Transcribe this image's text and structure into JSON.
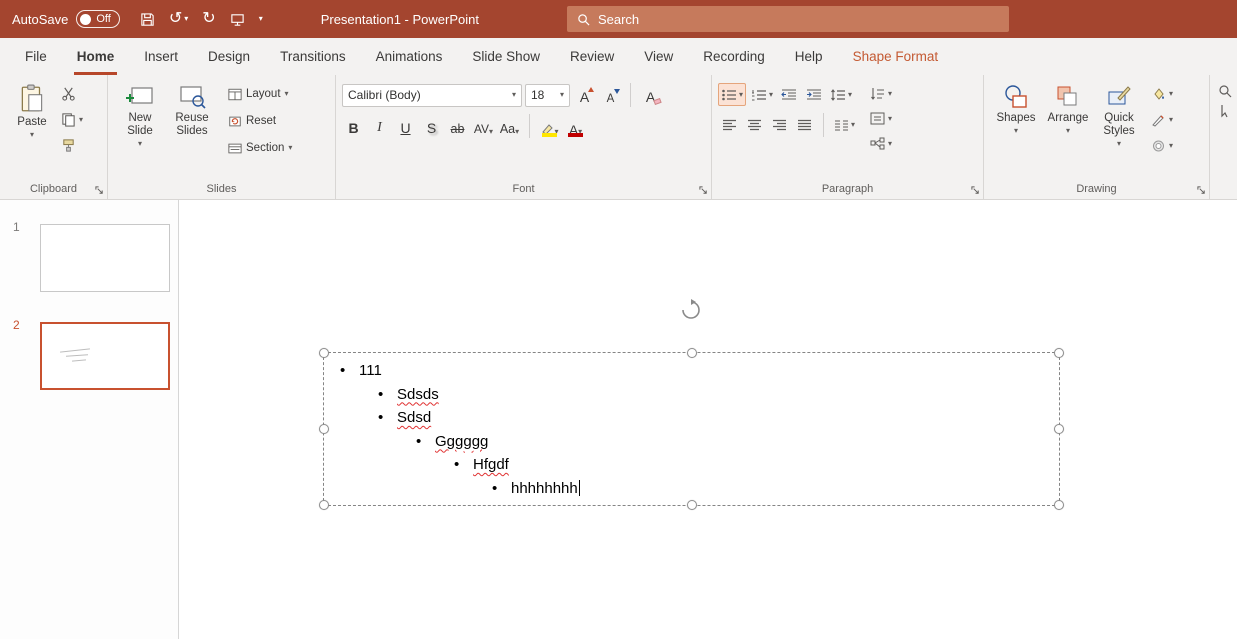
{
  "colors": {
    "titlebar": "#a4452f",
    "search_box": "#c67a5c",
    "accent": "#b7472a",
    "contextual_tab": "#c45a33",
    "selection": "#c8512f",
    "highlight_yellow": "#ffe600",
    "font_color_red": "#c00000",
    "squiggle_red": "#e03131"
  },
  "glyphs": {
    "chevron": "▾",
    "undo": "↺",
    "redo": "↻",
    "launcher": "↘"
  },
  "titlebar": {
    "autosave_label": "AutoSave",
    "autosave_state": "Off",
    "document_title": "Presentation1 - PowerPoint",
    "search_label": "Search"
  },
  "tabs": [
    {
      "label": "File"
    },
    {
      "label": "Home"
    },
    {
      "label": "Insert"
    },
    {
      "label": "Design"
    },
    {
      "label": "Transitions"
    },
    {
      "label": "Animations"
    },
    {
      "label": "Slide Show"
    },
    {
      "label": "Review"
    },
    {
      "label": "View"
    },
    {
      "label": "Recording"
    },
    {
      "label": "Help"
    },
    {
      "label": "Shape Format"
    }
  ],
  "groups": {
    "clipboard": {
      "label": "Clipboard",
      "paste": "Paste"
    },
    "slides": {
      "label": "Slides",
      "new_slide": "New Slide",
      "reuse_slides": "Reuse Slides",
      "layout": "Layout",
      "reset": "Reset",
      "section": "Section"
    },
    "font": {
      "label": "Font",
      "name_value": "Calibri (Body)",
      "size_value": "18",
      "bold": "B",
      "italic": "I",
      "underline": "U",
      "shadow": "S",
      "strikethrough": "ab",
      "char_spacing": "AV",
      "change_case": "Aa",
      "grow": "A",
      "shrink": "A",
      "clear": "A",
      "font_color": "A"
    },
    "paragraph": {
      "label": "Paragraph"
    },
    "drawing": {
      "label": "Drawing",
      "shapes": "Shapes",
      "arrange": "Arrange",
      "quick_styles": "Quick Styles"
    }
  },
  "slide_panel": {
    "slides": [
      {
        "number": "1"
      },
      {
        "number": "2"
      }
    ]
  },
  "slide": {
    "bullet_char": "•",
    "lines": [
      {
        "text": "111",
        "level": 0,
        "misspelled": false
      },
      {
        "text": "Sdsds",
        "level": 1,
        "misspelled": true
      },
      {
        "text": "Sdsd",
        "level": 1,
        "misspelled": true
      },
      {
        "text": "Gggggg",
        "level": 2,
        "misspelled": true
      },
      {
        "text": "Hfgdf",
        "level": 3,
        "misspelled": true
      },
      {
        "text": "hhhhhhhh",
        "level": 4,
        "misspelled": false,
        "has_cursor": true
      }
    ]
  }
}
